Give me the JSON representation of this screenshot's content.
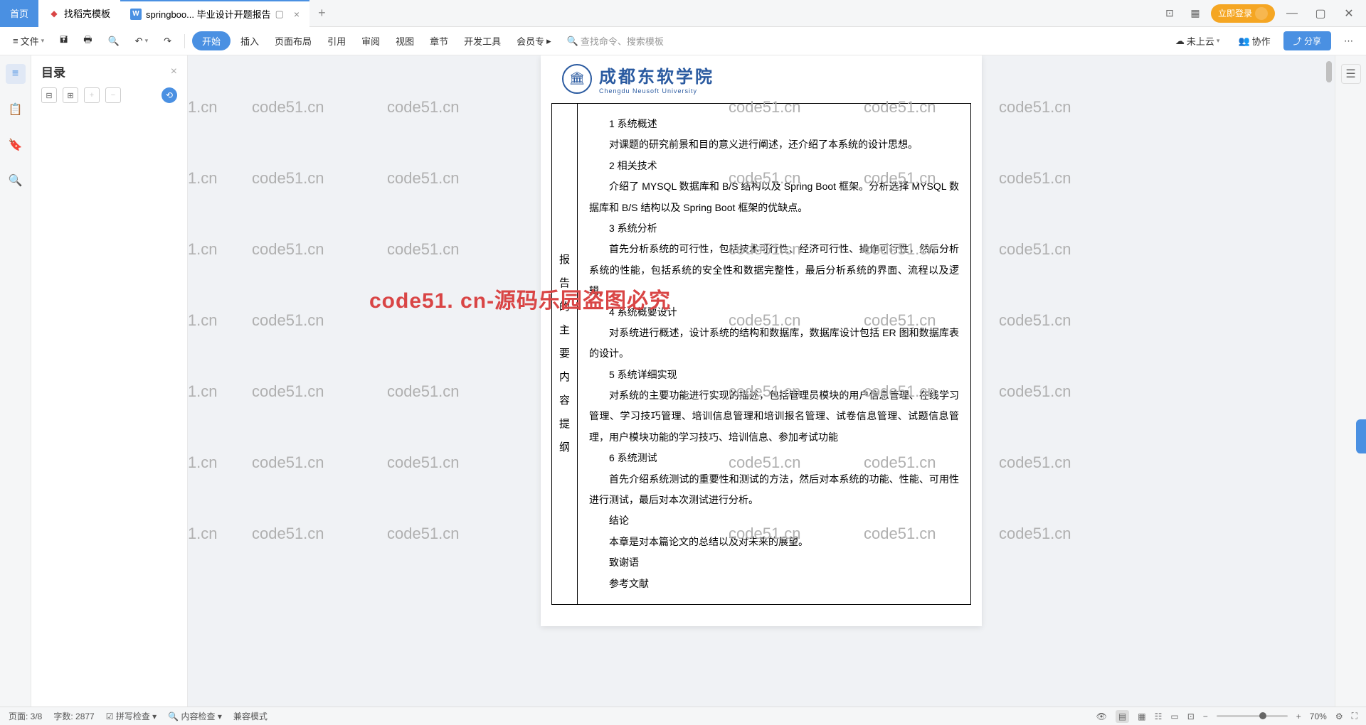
{
  "tabs": {
    "home": "首页",
    "template": "找稻壳模板",
    "active": "springboo... 毕业设计开题报告"
  },
  "login": "立即登录",
  "toolbar": {
    "file": "文件",
    "start": "开始",
    "insert": "插入",
    "layout": "页面布局",
    "ref": "引用",
    "review": "审阅",
    "view": "视图",
    "chapter": "章节",
    "devtools": "开发工具",
    "member": "会员专",
    "search": "查找命令、搜索模板",
    "cloud": "未上云",
    "collab": "协作",
    "share": "分享"
  },
  "sidebar": {
    "title": "目录"
  },
  "page": {
    "univ": "成都东软学院",
    "univ_en": "Chengdu Neusoft University",
    "label_chars": [
      "报",
      "告",
      "的",
      "主",
      "要",
      "内",
      "容",
      "提",
      "纲"
    ],
    "s1h": "1 系统概述",
    "s1p": "对课题的研究前景和目的意义进行阐述，还介绍了本系统的设计思想。",
    "s2h": "2 相关技术",
    "s2p": "介绍了 MYSQL 数据库和 B/S 结构以及 Spring Boot 框架。分析选择 MYSQL 数据库和 B/S 结构以及 Spring Boot 框架的优缺点。",
    "s3h": "3 系统分析",
    "s3p": "首先分析系统的可行性，包括技术可行性、经济可行性、操作可行性，然后分析系统的性能，包括系统的安全性和数据完整性，最后分析系统的界面、流程以及逻辑。",
    "s4h": "4 系统概要设计",
    "s4p": "对系统进行概述，设计系统的结构和数据库，数据库设计包括 ER 图和数据库表的设计。",
    "s5h": "5 系统详细实现",
    "s5p": "对系统的主要功能进行实现的描述，包括管理员模块的用户信息管理、在线学习管理、学习技巧管理、培训信息管理和培训报名管理、试卷信息管理、试题信息管理，用户模块功能的学习技巧、培训信息、参加考试功能",
    "s6h": "6 系统测试",
    "s6p": "首先介绍系统测试的重要性和测试的方法，然后对本系统的功能、性能、可用性进行测试，最后对本次测试进行分析。",
    "s7h": "结论",
    "s7p": "本章是对本篇论文的总结以及对未来的展望。",
    "s8h": "致谢语",
    "s9h": "参考文献"
  },
  "watermark": "code51.cn",
  "watermark_red": "code51. cn-源码乐园盗图必究",
  "status": {
    "page": "页面: 3/8",
    "words": "字数: 2877",
    "spell": "拼写检查",
    "content": "内容检查",
    "compat": "兼容模式",
    "zoom": "70%"
  }
}
